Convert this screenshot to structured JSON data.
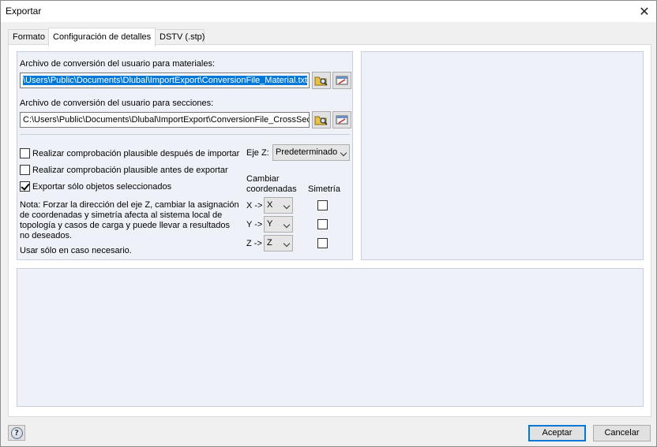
{
  "window": {
    "title": "Exportar",
    "close_symbol": "✕"
  },
  "tabs": [
    {
      "label": "Formato"
    },
    {
      "label": "Configuración de detalles"
    },
    {
      "label": "DSTV (.stp)"
    }
  ],
  "materials": {
    "label": "Archivo de conversión del usuario para materiales:",
    "path": "\\Users\\Public\\Documents\\Dlubal\\ImportExport\\ConversionFile_Material.txt"
  },
  "sections": {
    "label": "Archivo de conversión del usuario para secciones:",
    "path": "C:\\Users\\Public\\Documents\\Dlubal\\ImportExport\\ConversionFile_CrossSect"
  },
  "options": {
    "check_after_import": {
      "label": "Realizar comprobación plausible después de importar",
      "checked": false
    },
    "check_before_export": {
      "label": "Realizar comprobación plausible antes de exportar",
      "checked": false
    },
    "export_selected_only": {
      "label": "Exportar sólo objetos seleccionados",
      "checked": true
    }
  },
  "note": {
    "line1": "Nota: Forzar la dirección del eje Z, cambiar la asignación",
    "line2": "de coordenadas y simetría afecta al sistema local de",
    "line3": "topología y casos de carga y puede llevar a resultados",
    "line4": "no deseados.",
    "line5": "Usar sólo en caso necesario."
  },
  "z_axis": {
    "label": "Eje Z:",
    "value": "Predeterminado"
  },
  "coords": {
    "header_line1": "Cambiar",
    "header_line2": "coordenadas",
    "symmetry_header": "Simetría",
    "rows": [
      {
        "label": "X ->",
        "value": "X",
        "symmetry": false
      },
      {
        "label": "Y ->",
        "value": "Y",
        "symmetry": false
      },
      {
        "label": "Z ->",
        "value": "Z",
        "symmetry": false
      }
    ]
  },
  "buttons": {
    "accept": "Aceptar",
    "cancel": "Cancelar",
    "help": "?"
  }
}
